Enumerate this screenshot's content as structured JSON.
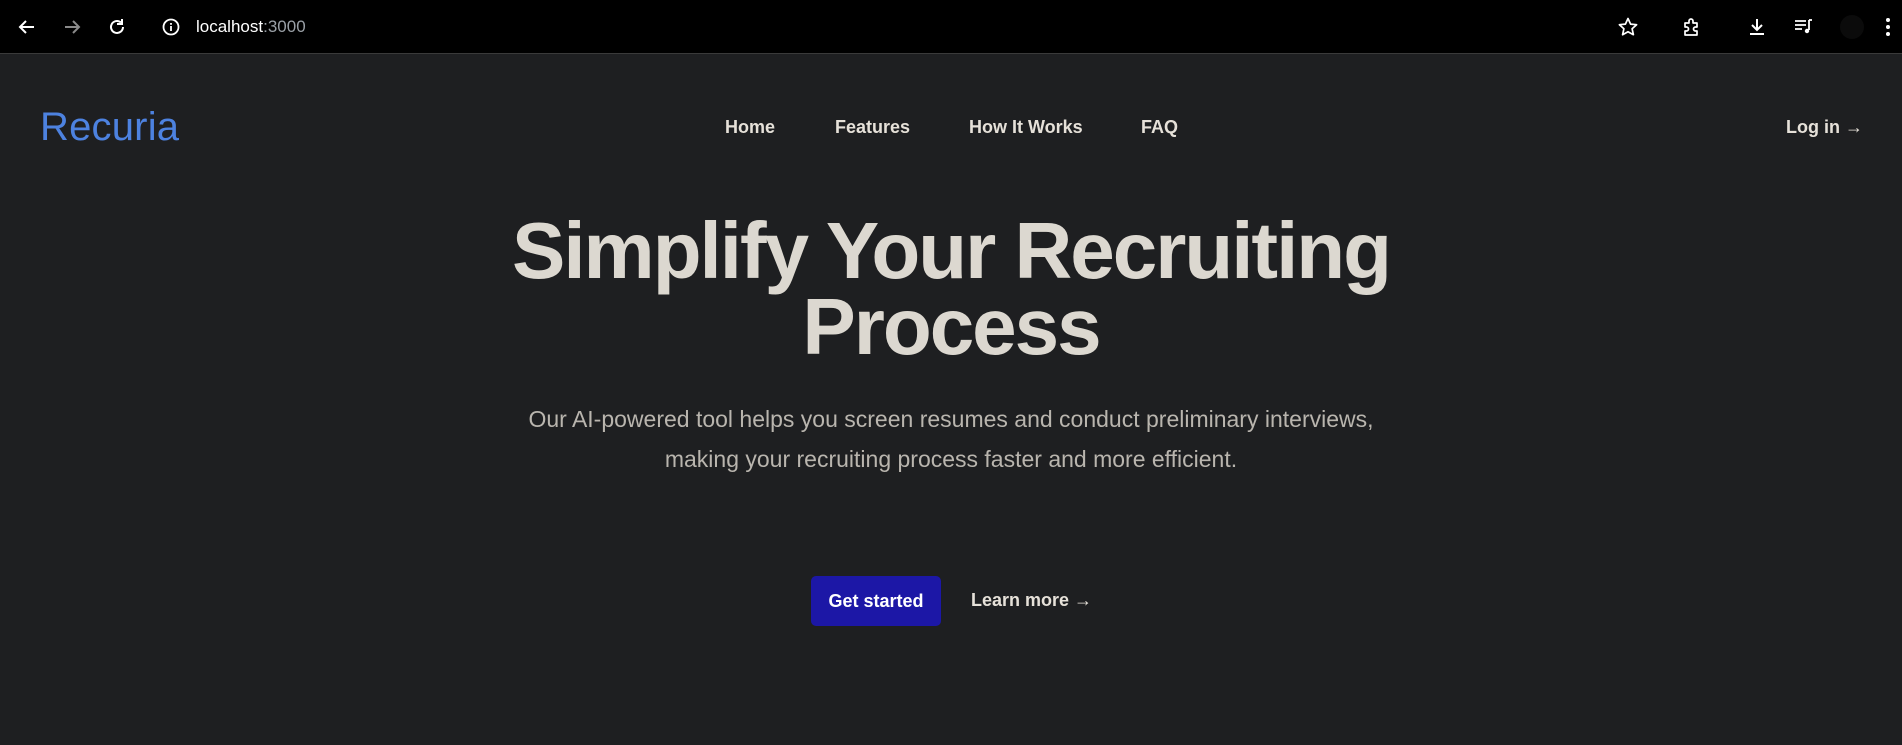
{
  "browser": {
    "url_host": "localhost",
    "url_port": ":3000",
    "icons": [
      "back-arrow-icon",
      "forward-arrow-icon",
      "reload-icon",
      "site-info-icon",
      "star-icon",
      "extensions-icon",
      "download-icon",
      "media-control-icon",
      "more-vert-icon"
    ]
  },
  "header": {
    "logo": "Recuria",
    "nav": [
      {
        "label": "Home"
      },
      {
        "label": "Features"
      },
      {
        "label": "How It Works"
      },
      {
        "label": "FAQ"
      }
    ],
    "login": "Log in →"
  },
  "hero": {
    "title_line1": "Simplify Your Recruiting",
    "title_line2": "Process",
    "subtitle_line1": "Our AI-powered tool helps you screen resumes and conduct preliminary interviews,",
    "subtitle_line2": "making your recruiting process faster and more efficient.",
    "primary_button": "Get started",
    "secondary_link": "Learn more →"
  },
  "colors": {
    "background": "#1e1f21",
    "logo": "#4d82e0",
    "primary_button": "#1c17a6",
    "text": "#e6e1d9"
  }
}
